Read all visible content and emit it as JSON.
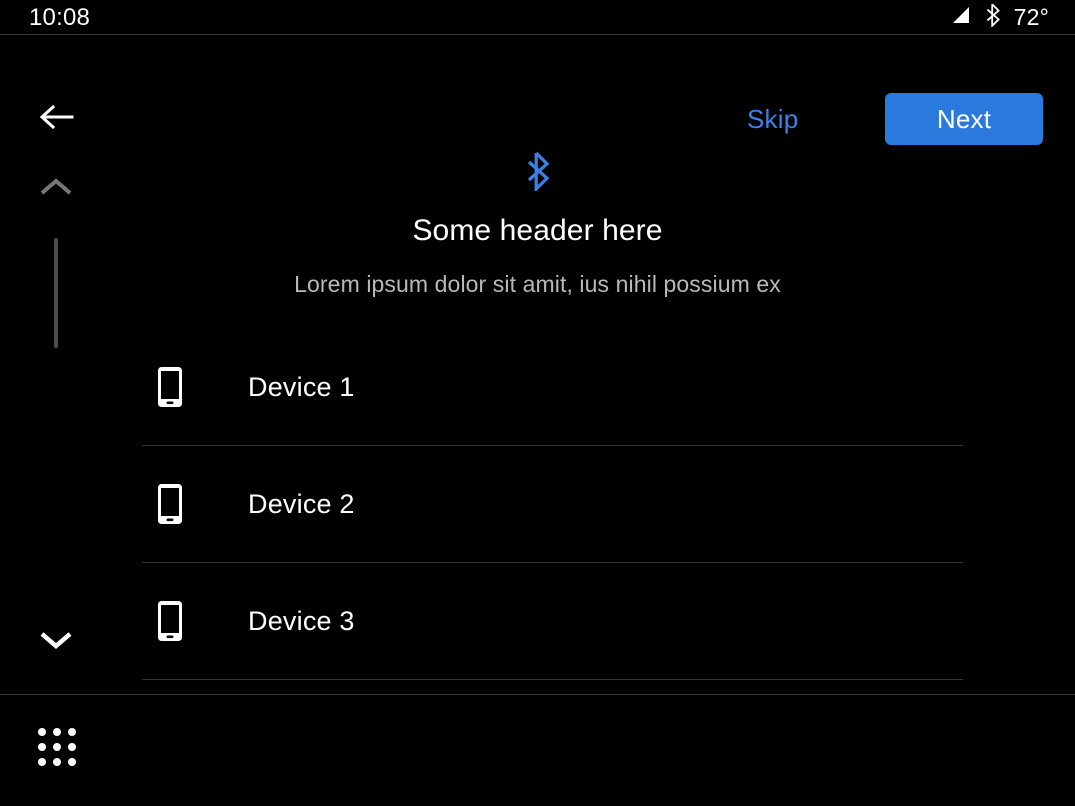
{
  "status_bar": {
    "time": "10:08",
    "temperature": "72°",
    "signal_icon": "cellular-signal-icon",
    "bluetooth_icon": "bluetooth-icon"
  },
  "nav_bar": {
    "back_icon": "back-arrow-icon",
    "skip_label": "Skip",
    "next_label": "Next",
    "next_button_color": "#2a7ade",
    "skip_text_color": "#3b82e8"
  },
  "left_rail": {
    "scroll_up_icon": "chevron-up-icon",
    "scroll_down_icon": "chevron-down-icon",
    "scrollbar_thumb_color": "#4d4d4d"
  },
  "content": {
    "hero_icon": "bluetooth-icon",
    "hero_icon_color": "#3b82e8",
    "header": "Some header here",
    "subheader": "Lorem ipsum dolor sit amit, ius nihil possium ex"
  },
  "devices": [
    {
      "icon": "smartphone-icon",
      "label": "Device 1"
    },
    {
      "icon": "smartphone-icon",
      "label": "Device 2"
    },
    {
      "icon": "smartphone-icon",
      "label": "Device 3"
    }
  ],
  "bottom_bar": {
    "app_grid_icon": "app-grid-icon"
  }
}
